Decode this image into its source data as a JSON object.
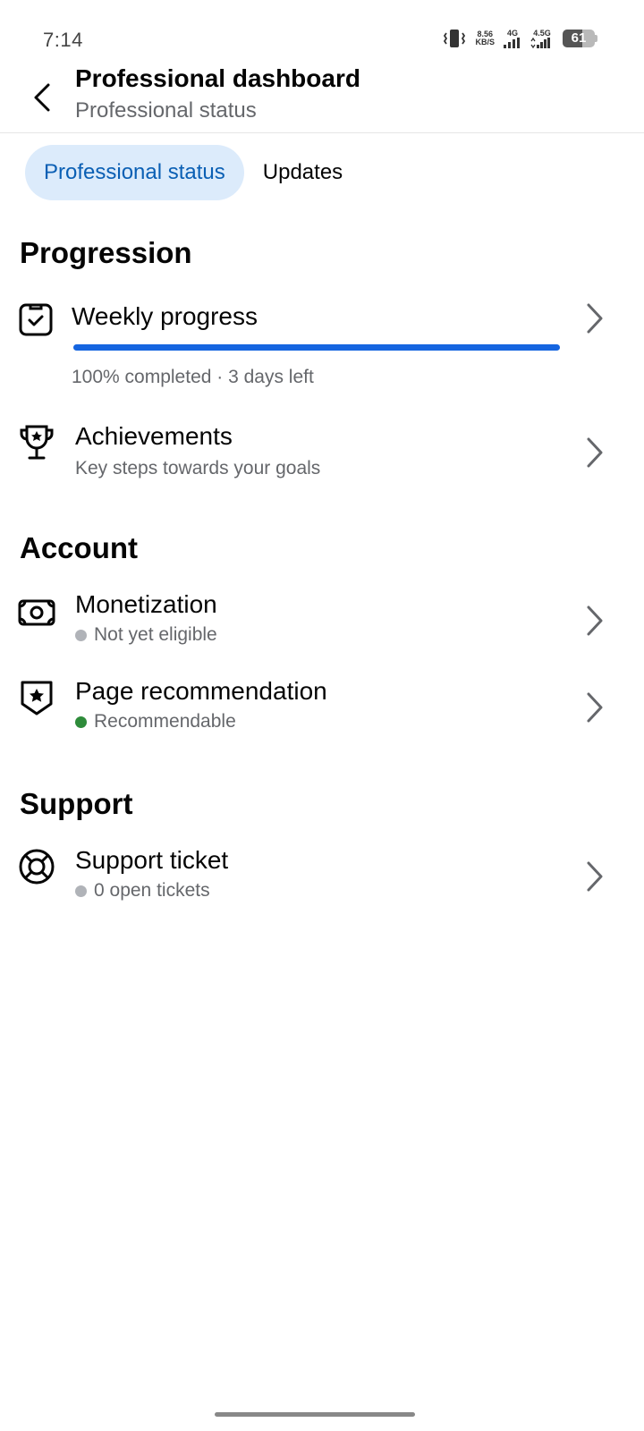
{
  "status_bar": {
    "time": "7:14",
    "speed_value": "8.56",
    "speed_unit": "KB/S",
    "net1": "4G",
    "net2": "4.5G",
    "battery": "61",
    "battery_level": 0.61
  },
  "header": {
    "title": "Professional dashboard",
    "subtitle": "Professional status"
  },
  "tabs": [
    {
      "label": "Professional status",
      "active": true
    },
    {
      "label": "Updates",
      "active": false
    }
  ],
  "progression": {
    "heading": "Progression",
    "weekly": {
      "title": "Weekly progress",
      "progress": 1.0,
      "status": "100% completed · 3 days left"
    },
    "achievements": {
      "title": "Achievements",
      "subtitle": "Key steps towards your goals"
    }
  },
  "account": {
    "heading": "Account",
    "monetization": {
      "title": "Monetization",
      "status": "Not yet eligible",
      "status_color": "#b0b3b8"
    },
    "page_recommendation": {
      "title": "Page recommendation",
      "status": "Recommendable",
      "status_color": "#2e8b3a"
    }
  },
  "support": {
    "heading": "Support",
    "ticket": {
      "title": "Support ticket",
      "status": "0 open tickets",
      "status_color": "#b0b3b8"
    }
  },
  "colors": {
    "accent": "#1565e0",
    "tab_active_bg": "#dcebfb",
    "tab_active_text": "#0a5fb4"
  }
}
